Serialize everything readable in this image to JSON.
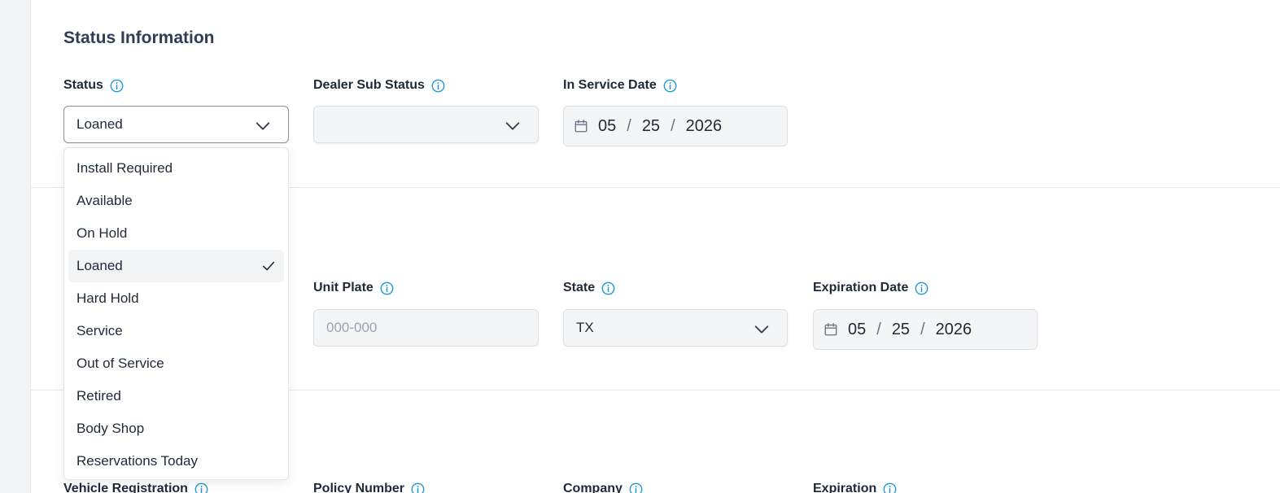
{
  "section": {
    "title": "Status Information"
  },
  "status": {
    "label": "Status",
    "value": "Loaned",
    "options": [
      "Install Required",
      "Available",
      "On Hold",
      "Loaned",
      "Hard Hold",
      "Service",
      "Out of Service",
      "Retired",
      "Body Shop",
      "Reservations Today"
    ],
    "selected_index": 3
  },
  "dealer_sub_status": {
    "label": "Dealer Sub Status",
    "value": ""
  },
  "in_service_date": {
    "label": "In Service Date",
    "month": "05",
    "day": "25",
    "year": "2026",
    "sep": "/"
  },
  "unit_plate": {
    "label": "Unit Plate",
    "placeholder": "000-000",
    "value": ""
  },
  "state": {
    "label": "State",
    "value": "TX"
  },
  "expiration_date": {
    "label": "Expiration Date",
    "month": "05",
    "day": "25",
    "year": "2026",
    "sep": "/"
  },
  "bottom_labels": {
    "vehicle_registration": "Vehicle Registration",
    "policy_number": "Policy Number",
    "company": "Company",
    "expiration": "Expiration"
  },
  "colors": {
    "info_icon": "#1b9ad6",
    "label_text": "#1f2937",
    "title_text": "#2f3d57"
  }
}
